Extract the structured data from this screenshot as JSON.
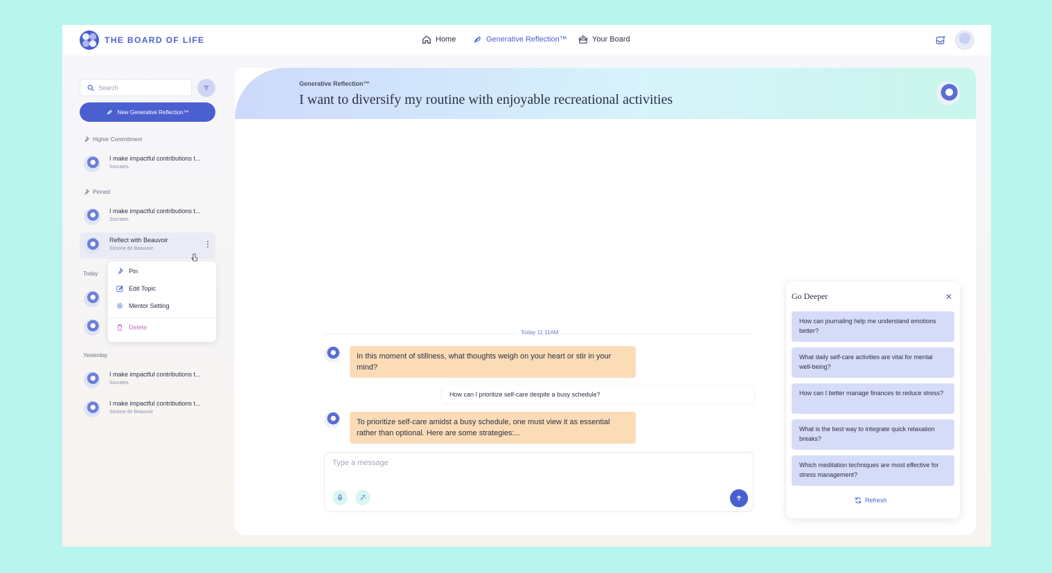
{
  "app": {
    "name": "THE BOARD OF LIFE"
  },
  "nav": {
    "home": "Home",
    "generative": "Generative Reflection™",
    "board": "Your Board"
  },
  "sidebar": {
    "search_placeholder": "Search",
    "new_button": "New Generative Reflection™",
    "sections": {
      "higher_commitment": "Higher Commitment",
      "pinned": "Pinned",
      "today": "Today",
      "yesterday": "Yesterday"
    },
    "higher_items": [
      {
        "title": "I make impactful contributions t...",
        "mentor": "Socrates"
      }
    ],
    "pinned_items": [
      {
        "title": "I make impactful contributions t...",
        "mentor": "Socrates"
      },
      {
        "title": "Reflect with Beauvoir",
        "mentor": "Simone de Beauvoir"
      }
    ],
    "yesterday_items": [
      {
        "title": "I make impactful contributions t...",
        "mentor": "Socrates"
      },
      {
        "title": "I make impactful contributions t...",
        "mentor": "Simone de Beauvoir"
      }
    ],
    "context_menu": {
      "pin": "Pin",
      "edit": "Edit Topic",
      "mentor": "Mentor Setting",
      "delete": "Delete"
    }
  },
  "main": {
    "label": "Generative Reflection™",
    "title": "I want to diversify my routine with enjoyable recreational activities",
    "timestamp": "Today 11:11AM",
    "messages": [
      {
        "role": "bot",
        "text": "In this moment of stillness, what thoughts weigh on your heart or stir in your mind?"
      },
      {
        "role": "user",
        "text": "How can I prioritize self-care despite a busy schedule?"
      },
      {
        "role": "bot",
        "text": "To prioritize self-care amidst a busy schedule, one must view it as essential rather than optional. Here are some strategies:..."
      }
    ],
    "composer_placeholder": "Type a message"
  },
  "deeper": {
    "title": "Go Deeper",
    "suggestions": [
      "How can journaling help me understand emotions better?",
      "What daily self-care activities are vital for mental well-being?",
      "How can I better manage finances to reduce stress?",
      "What is the best way to integrate quick relaxation breaks?",
      "Which meditation techniques are most effective for stress management?"
    ],
    "refresh": "Refresh"
  },
  "colors": {
    "brand": "#4a5fd0",
    "bot_bubble": "#fcdcb7",
    "suggestion": "#d6dcf8",
    "danger": "#c86bc8",
    "background": "#b8f5ec"
  }
}
